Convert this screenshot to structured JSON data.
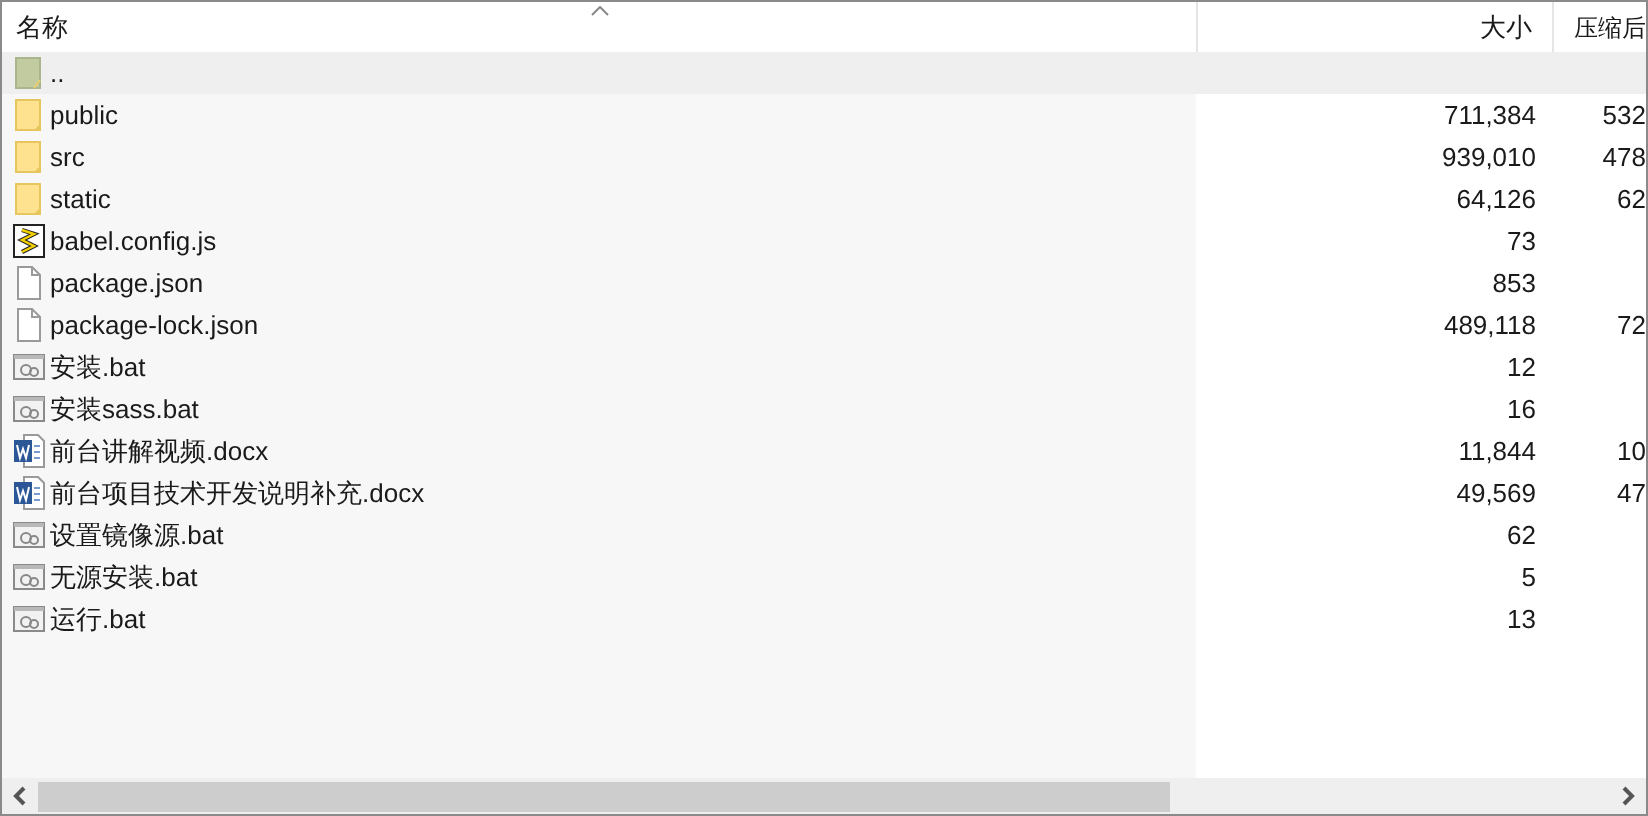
{
  "columns": [
    {
      "label": "名称",
      "sorted": true
    },
    {
      "label": "大小",
      "sorted": false
    },
    {
      "label": "压缩后",
      "sorted": false
    }
  ],
  "rows": [
    {
      "kind": "parent",
      "name": "..",
      "size": "",
      "packed": "",
      "selected": true
    },
    {
      "kind": "folder",
      "name": "public",
      "size": "711,384",
      "packed": "532",
      "selected": false
    },
    {
      "kind": "folder",
      "name": "src",
      "size": "939,010",
      "packed": "478",
      "selected": false
    },
    {
      "kind": "folder",
      "name": "static",
      "size": "64,126",
      "packed": "62",
      "selected": false
    },
    {
      "kind": "script",
      "name": "babel.config.js",
      "size": "73",
      "packed": "",
      "selected": false
    },
    {
      "kind": "file",
      "name": "package.json",
      "size": "853",
      "packed": "",
      "selected": false
    },
    {
      "kind": "file",
      "name": "package-lock.json",
      "size": "489,118",
      "packed": "72",
      "selected": false
    },
    {
      "kind": "batch",
      "name": "安装.bat",
      "size": "12",
      "packed": "",
      "selected": false
    },
    {
      "kind": "batch",
      "name": "安装sass.bat",
      "size": "16",
      "packed": "",
      "selected": false
    },
    {
      "kind": "document",
      "name": "前台讲解视频.docx",
      "size": "11,844",
      "packed": "10",
      "selected": false
    },
    {
      "kind": "document",
      "name": "前台项目技术开发说明补充.docx",
      "size": "49,569",
      "packed": "47",
      "selected": false
    },
    {
      "kind": "batch",
      "name": "设置镜像源.bat",
      "size": "62",
      "packed": "",
      "selected": false
    },
    {
      "kind": "batch",
      "name": "无源安装.bat",
      "size": "5",
      "packed": "",
      "selected": false
    },
    {
      "kind": "batch",
      "name": "运行.bat",
      "size": "13",
      "packed": "",
      "selected": false
    }
  ]
}
